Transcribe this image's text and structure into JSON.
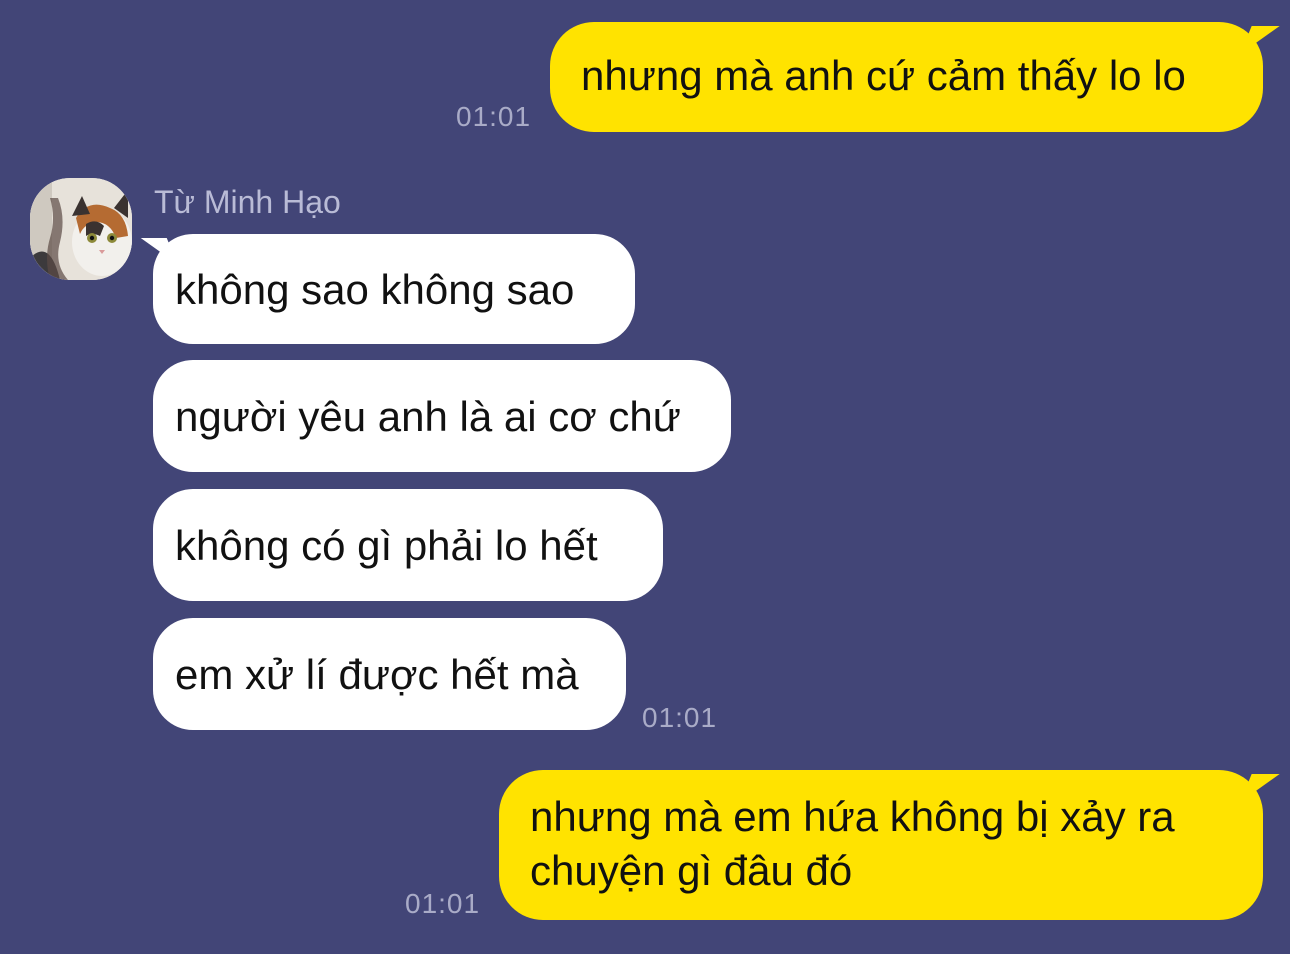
{
  "conversation": {
    "contact": {
      "name": "Từ Minh Hạo"
    },
    "messages": [
      {
        "direction": "outgoing",
        "text": "nhưng mà anh cứ cảm thấy lo lo",
        "time": "01:01"
      },
      {
        "direction": "incoming",
        "text": "không sao không sao"
      },
      {
        "direction": "incoming",
        "text": "người yêu anh là ai cơ chứ"
      },
      {
        "direction": "incoming",
        "text": "không có gì phải lo hết"
      },
      {
        "direction": "incoming",
        "text": "em xử lí được hết mà",
        "time": "01:01"
      },
      {
        "direction": "outgoing",
        "lines": [
          "nhưng mà em hứa không bị xảy ra",
          "chuyện gì đâu đó"
        ],
        "time": "01:01"
      }
    ]
  },
  "colors": {
    "background": "#424577",
    "outgoing_bubble": "#ffe300",
    "incoming_bubble": "#ffffff",
    "timestamp": "#a9abc7"
  },
  "icons": {
    "avatar": "cat-photo-avatar"
  }
}
